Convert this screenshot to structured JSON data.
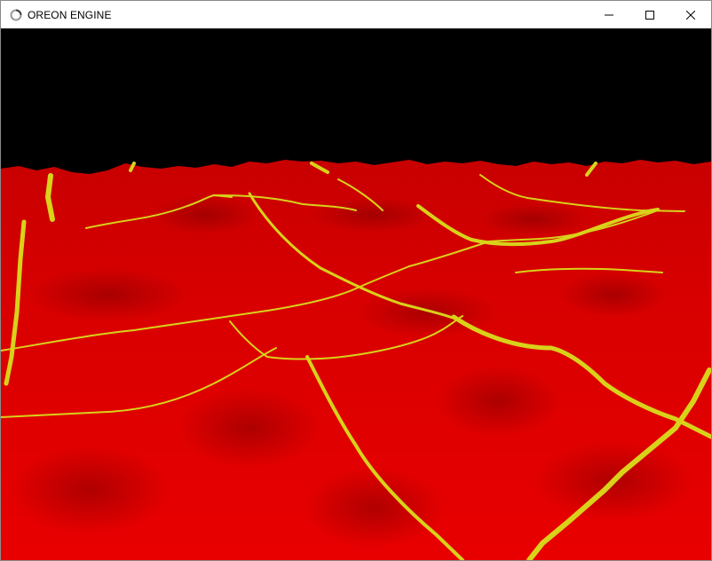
{
  "window": {
    "title": "OREON ENGINE",
    "icon": "loading-ring-icon",
    "controls": [
      "minimize-icon",
      "maximize-icon",
      "close-icon"
    ]
  },
  "scene": {
    "description_free": true,
    "sky_color": "#000000",
    "terrain_color": "#e00000",
    "contour_color": "#d8d21a"
  }
}
